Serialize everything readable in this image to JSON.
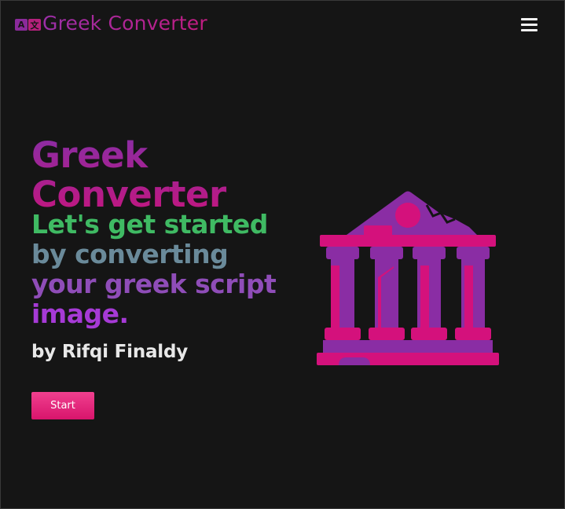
{
  "navbar": {
    "brand_icon_left": "A",
    "brand_icon_right": "文",
    "brand_title": "Greek Converter",
    "menu_icon": "hamburger-menu-icon"
  },
  "hero": {
    "title": "Greek Converter",
    "tagline": [
      "Let's get started",
      "by converting",
      "your greek script",
      "image."
    ],
    "author": "by Rifqi Finaldy",
    "start_label": "Start",
    "illustration_icon": "greek-temple-icon"
  },
  "colors": {
    "background": "#151515",
    "brand_purple": "#8a2da4",
    "brand_magenta": "#c2167f",
    "green": "#3fba63",
    "slate": "#6a8a9a",
    "purple": "#8f4db8",
    "violet": "#a63ad6",
    "button_pink": "#e8287c"
  }
}
